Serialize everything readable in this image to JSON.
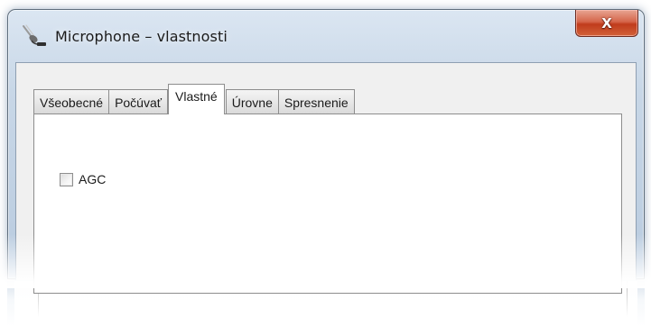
{
  "window": {
    "title": "Microphone – vlastnosti",
    "close_glyph": "X",
    "app_icon": "microphone-icon"
  },
  "tabs": [
    {
      "label": "Všeobecné",
      "active": false
    },
    {
      "label": "Počúvať",
      "active": false
    },
    {
      "label": "Vlastné",
      "active": true
    },
    {
      "label": "Úrovne",
      "active": false
    },
    {
      "label": "Spresnenie",
      "active": false
    }
  ],
  "panel": {
    "agc": {
      "label": "AGC",
      "checked": false
    }
  },
  "colors": {
    "close_button": "#c8442a",
    "frame": "#c8d7e7",
    "client": "#f0f0f0"
  }
}
